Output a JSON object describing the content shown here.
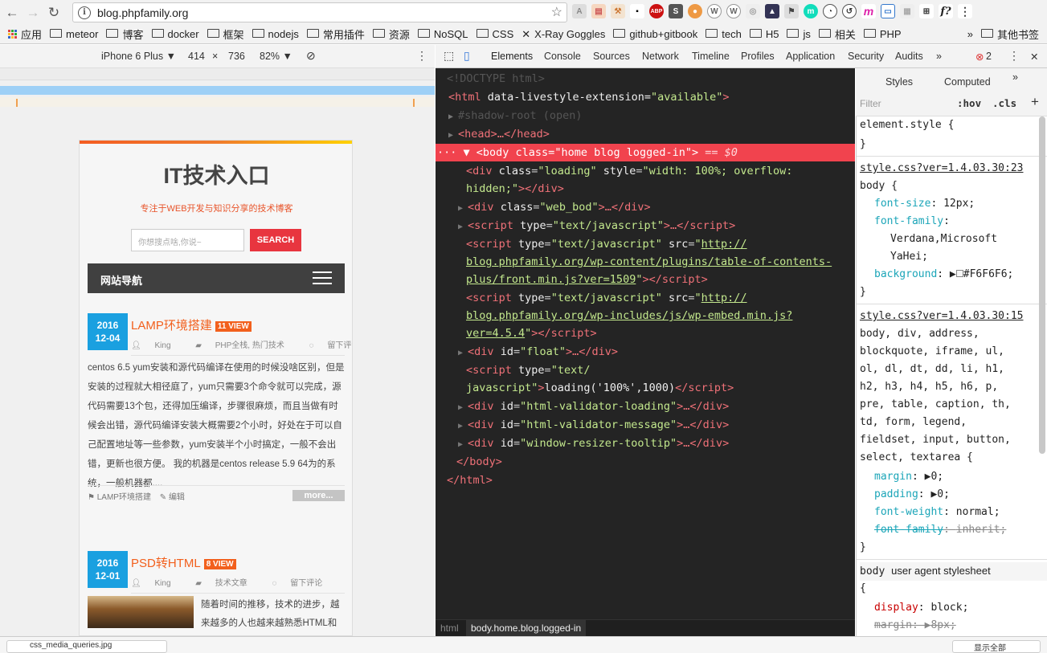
{
  "browser": {
    "url": "blog.phpfamily.org",
    "bookmarks": [
      "应用",
      "meteor",
      "博客",
      "docker",
      "框架",
      "nodejs",
      "常用插件",
      "资源",
      "NoSQL",
      "CSS",
      "X-Ray Goggles",
      "github+gitbook",
      "tech",
      "H5",
      "js",
      "相关",
      "PHP"
    ],
    "other_bookmarks": "其他书签"
  },
  "device_toolbar": {
    "device": "iPhone 6 Plus ▼",
    "width": "414",
    "times": "×",
    "height": "736",
    "zoom": "82% ▼"
  },
  "site": {
    "title": "IT技术入口",
    "subtitle": "专注于WEB开发与知识分享的技术博客",
    "search_placeholder": "你想搜点啥,你说~",
    "search_button": "SEARCH",
    "nav_label": "网站导航",
    "posts": [
      {
        "year": "2016",
        "day": "12-04",
        "title": "LAMP环境搭建",
        "views": "11 VIEW",
        "author": "King",
        "category": "PHP全栈, 热门技术",
        "comment": "留下评论",
        "excerpt": "centos 6.5 yum安装和源代码编译在使用的时候没啥区别，但是安装的过程就大相径庭了，yum只需要3个命令就可以完成，源代码需要13个包，还得加压编译，步骤很麻烦，而且当做有时候会出错，源代码编译安装大概需要2个小时，好处在于可以自己配置地址等一些参数，yum安装半个小时搞定，一般不会出错，更新也很方便。 我的机器是centos release 5.9 64为的系统，一般机器都....",
        "tag": "LAMP环境搭建",
        "edit": "编辑",
        "more": "more..."
      },
      {
        "year": "2016",
        "day": "12-01",
        "title": "PSD转HTML",
        "views": "8 VIEW",
        "author": "King",
        "category": "技术文章",
        "comment": "留下评论",
        "excerpt": "随着时间的推移，技术的进步，越来越多的人也越来越熟悉HTML和"
      }
    ]
  },
  "devtools": {
    "tabs": [
      "Elements",
      "Console",
      "Sources",
      "Network",
      "Timeline",
      "Profiles",
      "Application",
      "Security",
      "Audits"
    ],
    "error_count": "2",
    "tree": {
      "doctype": "<!DOCTYPE html>",
      "html_attr": "data-livestyle-extension",
      "html_val": "\"available\"",
      "shadow": "#shadow-root (open)",
      "head": "<head>…</head>",
      "body_class": "\"home blog logged-in\"",
      "body_eq": "== $0",
      "loading_style1": "\"width: 100%; overflow:",
      "loading_style2": "hidden;\"",
      "webbod": "\"web_bod\"",
      "script_type": "\"text/javascript\"",
      "src1a": "http://",
      "src1b": "blog.phpfamily.org/wp-content/plugins/table-of-contents-",
      "src1c": "plus/front.min.js?ver=1509",
      "src2a": "http://",
      "src2b": "blog.phpfamily.org/wp-includes/js/wp-embed.min.js?",
      "src2c": "ver=4.5.4",
      "float_id": "\"float\"",
      "inline_type1": "\"text/",
      "inline_type2": "javascript\"",
      "inline_code": "loading('100%',1000)",
      "id1": "\"html-validator-loading\"",
      "id2": "\"html-validator-message\"",
      "id3": "\"window-resizer-tooltip\""
    },
    "breadcrumb": [
      "html",
      "body.home.blog.logged-in"
    ],
    "styles": {
      "tabs": [
        "Styles",
        "Computed"
      ],
      "filter_placeholder": "Filter",
      "hov": ":hov",
      "cls": ".cls",
      "element_style": "element.style {",
      "src1": "style.css?ver=1.4.03.30:23",
      "src2": "style.css?ver=1.4.03.30:15",
      "font_size": "12px;",
      "font_family1": "Verdana,Microsoft",
      "font_family2": "YaHei;",
      "background": "#F6F6F6;",
      "selectors": [
        "body, div, address,",
        "blockquote, iframe, ul,",
        "ol, dl, dt, dd, li, h1,",
        "h2, h3, h4, h5, h6, p,",
        "pre, table, caption, th,",
        "td, form, legend,",
        "fieldset, input, button,",
        "select, textarea {"
      ],
      "margin": "0;",
      "padding": "0;",
      "font_weight": "normal;",
      "font_family_inherit": "inherit;",
      "ua_label": "user agent stylesheet",
      "display": "block;",
      "ua_margin": "8px;"
    }
  },
  "download": {
    "file": "css_media_queries.jpg",
    "show_all": "显示全部"
  }
}
